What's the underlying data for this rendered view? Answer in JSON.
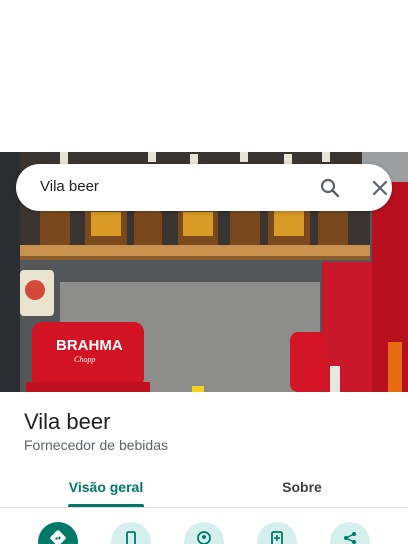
{
  "search": {
    "query": "Vila beer"
  },
  "place": {
    "name": "Vila beer",
    "category": "Fornecedor de bebidas"
  },
  "tabs": [
    {
      "label": "Visão geral",
      "active": true
    },
    {
      "label": "Sobre",
      "active": false
    }
  ],
  "photo": {
    "sign_text": "BRAHMA",
    "sign_subtext": "Chopp"
  },
  "actions": [
    {
      "icon": "directions-icon",
      "primary": true
    },
    {
      "icon": "phone-icon",
      "primary": false
    },
    {
      "icon": "location-pin-icon",
      "primary": false
    },
    {
      "icon": "save-icon",
      "primary": false
    },
    {
      "icon": "share-icon",
      "primary": false
    }
  ],
  "colors": {
    "accent": "#00796b",
    "action_bg": "#d5f0ec",
    "title": "#202124",
    "subtitle": "#5f6368"
  }
}
